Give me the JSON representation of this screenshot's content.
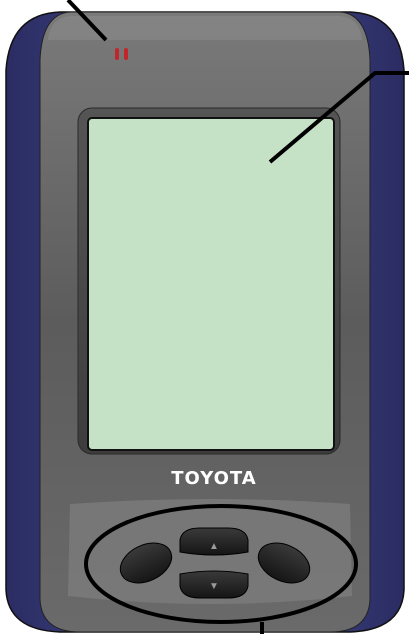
{
  "device": {
    "brand_label": "TOYOTA",
    "led_icon": "status-led-icon",
    "screen_color": "#c5e2c6",
    "bumper_color": "#3b3d7a",
    "body_color": "#666666",
    "screen_state": "blank",
    "keypad": {
      "up_icon": "arrow-up-icon",
      "down_icon": "arrow-down-icon",
      "left_button_icon": "oval-button-icon",
      "right_button_icon": "oval-button-icon",
      "up_glyph": "▲",
      "down_glyph": "▼"
    }
  },
  "callouts": [
    {
      "target": "status-led"
    },
    {
      "target": "display-screen"
    },
    {
      "target": "keypad"
    }
  ]
}
